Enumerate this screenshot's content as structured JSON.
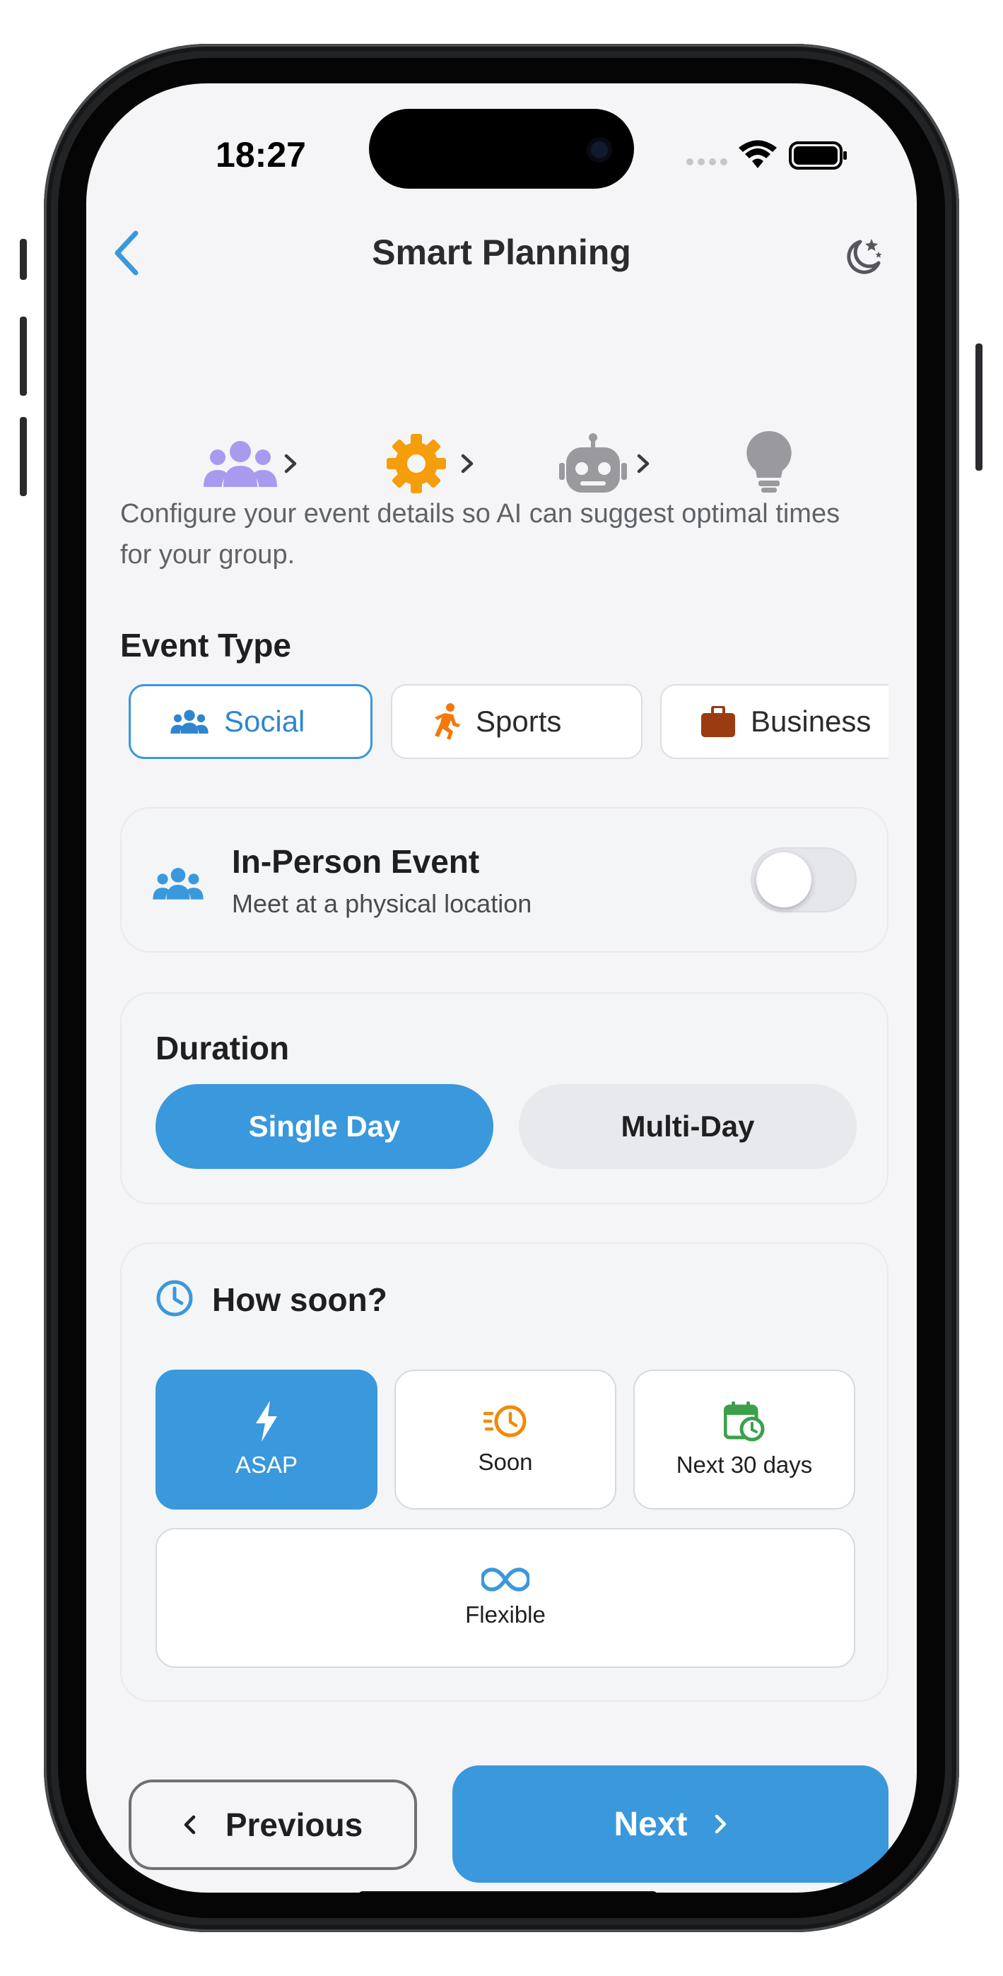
{
  "status": {
    "time": "18:27"
  },
  "header": {
    "title": "Smart Planning"
  },
  "steps": [
    "group-icon",
    "settings-icon",
    "robot-icon",
    "lightbulb-icon"
  ],
  "intro": "Configure your event details so AI can suggest optimal times for your group.",
  "event_type": {
    "label": "Event Type",
    "options": [
      {
        "label": "Social",
        "icon": "group-icon",
        "selected": true
      },
      {
        "label": "Sports",
        "icon": "running-icon",
        "selected": false
      },
      {
        "label": "Business",
        "icon": "briefcase-icon",
        "selected": false
      }
    ]
  },
  "in_person": {
    "title": "In-Person Event",
    "subtitle": "Meet at a physical location",
    "enabled": false
  },
  "duration": {
    "label": "Duration",
    "options": [
      "Single Day",
      "Multi-Day"
    ],
    "selected": "Single Day"
  },
  "how_soon": {
    "label": "How soon?",
    "options": [
      {
        "label": "ASAP",
        "icon": "bolt-icon",
        "selected": true
      },
      {
        "label": "Soon",
        "icon": "fast-clock-icon",
        "selected": false
      },
      {
        "label": "Next 30 days",
        "icon": "calendar-clock-icon",
        "selected": false
      },
      {
        "label": "Flexible",
        "icon": "infinity-icon",
        "selected": false
      }
    ]
  },
  "nav": {
    "previous_label": "Previous",
    "next_label": "Next"
  },
  "colors": {
    "accent": "#3a98dc",
    "step_active": "#f59e0b",
    "step_done": "#a99af0",
    "step_pending": "#9a9a9e"
  }
}
